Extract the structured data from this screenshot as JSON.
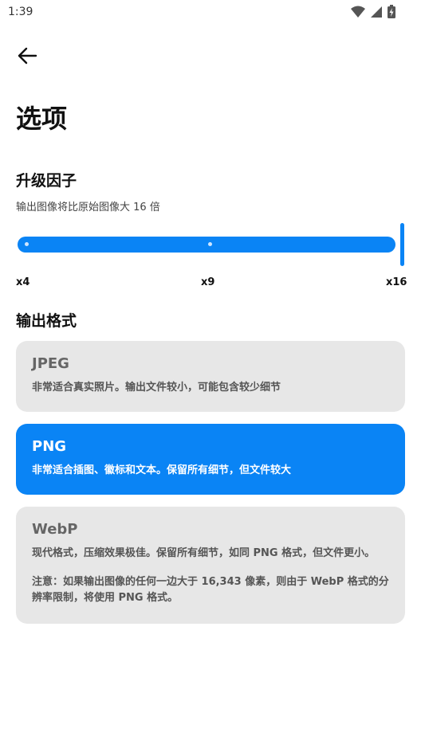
{
  "status_bar": {
    "time": "1:39"
  },
  "header": {
    "title": "选项"
  },
  "upscale": {
    "section_title": "升级因子",
    "subtitle": "输出图像将比原始图像大 16 倍",
    "value": 16,
    "ticks": [
      "x4",
      "x9",
      "x16"
    ]
  },
  "format": {
    "section_title": "输出格式",
    "options": [
      {
        "name": "JPEG",
        "description": "非常适合真实照片。输出文件较小，可能包含较少细节",
        "selected": false
      },
      {
        "name": "PNG",
        "description": "非常适合插图、徽标和文本。保留所有细节，但文件较大",
        "selected": true
      },
      {
        "name": "WebP",
        "description": "现代格式，压缩效果极佳。保留所有细节，如同 PNG 格式，但文件更小。",
        "note": "注意：如果输出图像的任何一边大于 16,343 像素，则由于 WebP 格式的分辨率限制，将使用 PNG 格式。",
        "selected": false
      }
    ]
  },
  "colors": {
    "accent": "#0a84f5",
    "card_bg": "#e7e7e7"
  }
}
